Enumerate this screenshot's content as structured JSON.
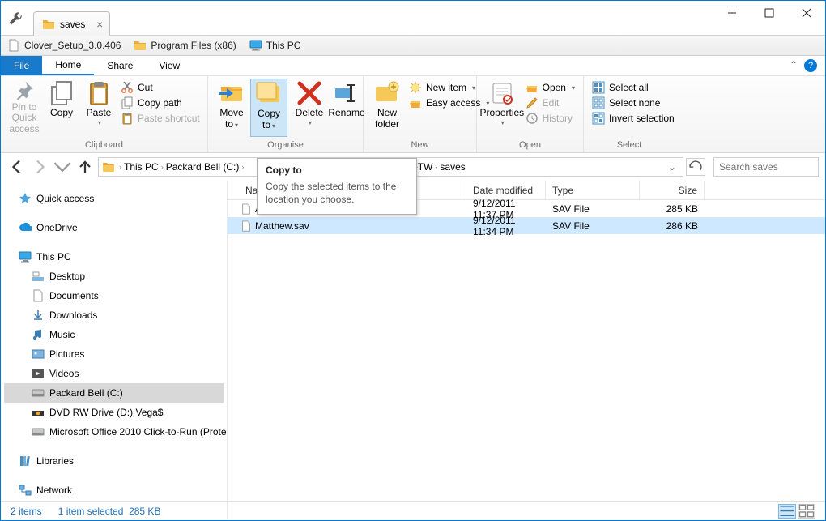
{
  "tab_title": "saves",
  "bookmarks": [
    {
      "label": "Clover_Setup_3.0.406",
      "icon": "file"
    },
    {
      "label": "Program Files (x86)",
      "icon": "folder"
    },
    {
      "label": "This PC",
      "icon": "monitor"
    }
  ],
  "menu": {
    "file": "File",
    "home": "Home",
    "share": "Share",
    "view": "View"
  },
  "ribbon": {
    "clipboard": {
      "label": "Clipboard",
      "pin": "Pin to Quick access",
      "copy": "Copy",
      "paste": "Paste",
      "cut": "Cut",
      "copy_path": "Copy path",
      "paste_shortcut": "Paste shortcut"
    },
    "organise": {
      "label": "Organise",
      "move_to": "Move to",
      "copy_to": "Copy to",
      "delete": "Delete",
      "rename": "Rename"
    },
    "new": {
      "label": "New",
      "new_folder": "New folder",
      "new_item": "New item",
      "easy_access": "Easy access"
    },
    "open": {
      "label": "Open",
      "properties": "Properties",
      "open": "Open",
      "edit": "Edit",
      "history": "History"
    },
    "select": {
      "label": "Select",
      "all": "Select all",
      "none": "Select none",
      "invert": "Invert selection"
    }
  },
  "tooltip": {
    "title": "Copy to",
    "body": "Copy the selected items to the location you choose."
  },
  "breadcrumb": [
    "This PC",
    "Packard Bell (C:)",
    "neTW",
    "saves"
  ],
  "breadcrumb_hidden_end": "neTW",
  "search_placeholder": "Search saves",
  "columns": {
    "name": "Name",
    "date": "Date modified",
    "type": "Type",
    "size": "Size"
  },
  "rows": [
    {
      "name": "Autosave.sav",
      "date": "9/12/2011 11:37 PM",
      "type": "SAV File",
      "size": "285 KB",
      "selected": false
    },
    {
      "name": "Matthew.sav",
      "date": "9/12/2011 11:34 PM",
      "type": "SAV File",
      "size": "286 KB",
      "selected": true
    }
  ],
  "tree": {
    "quick_access": "Quick access",
    "onedrive": "OneDrive",
    "this_pc": "This PC",
    "items": [
      "Desktop",
      "Documents",
      "Downloads",
      "Music",
      "Pictures",
      "Videos",
      "Packard Bell (C:)",
      "DVD RW Drive (D:) Vega$",
      "Microsoft Office 2010 Click-to-Run (Prote"
    ],
    "libraries": "Libraries",
    "network": "Network"
  },
  "status": {
    "count": "2 items",
    "selected": "1 item selected",
    "size": "285 KB"
  }
}
